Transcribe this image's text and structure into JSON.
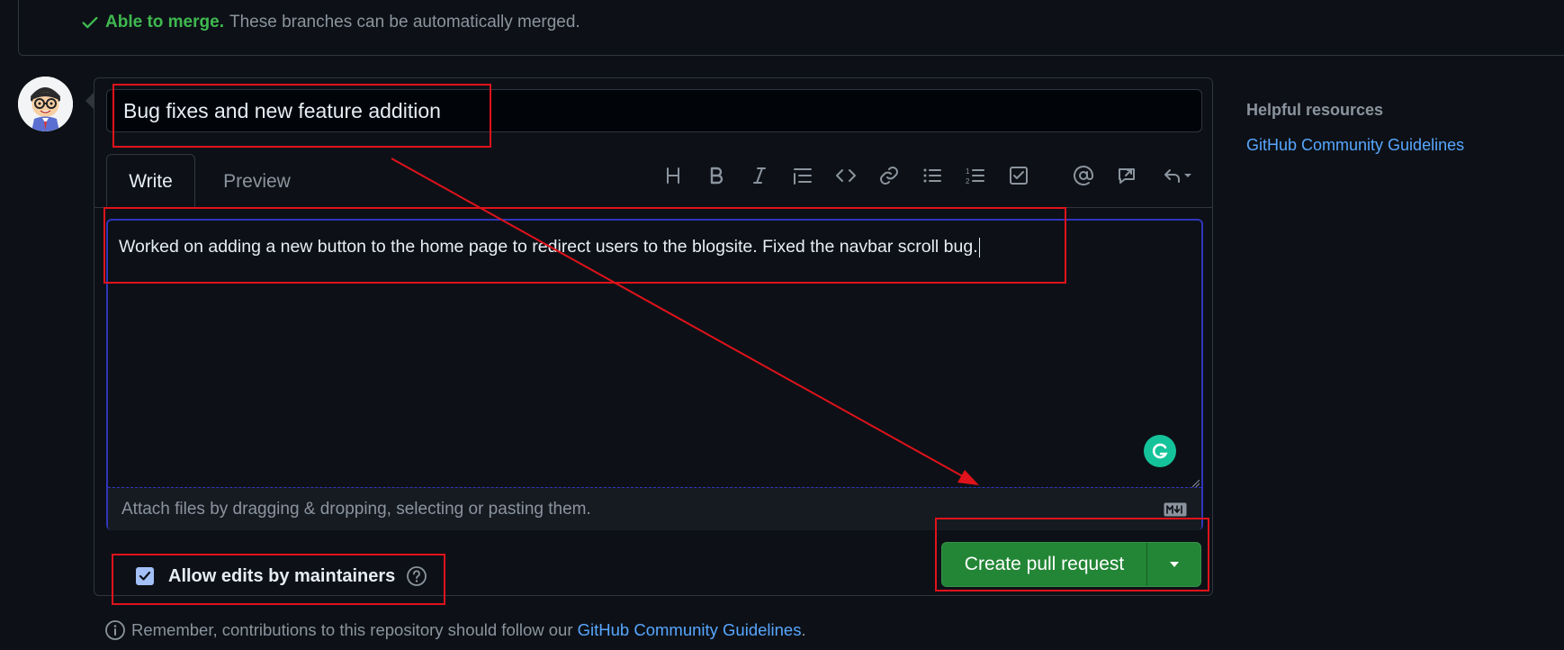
{
  "merge": {
    "status_strong": "Able to merge.",
    "status_text": "These branches can be automatically merged."
  },
  "form": {
    "title_value": "Bug fixes and new feature addition",
    "tabs": [
      {
        "label": "Write",
        "selected": true
      },
      {
        "label": "Preview",
        "selected": false
      }
    ],
    "toolbar_icons": [
      "heading-icon",
      "bold-icon",
      "italic-icon",
      "quote-icon",
      "code-icon",
      "link-icon",
      "bulleted-list-icon",
      "numbered-list-icon",
      "task-list-icon",
      "mention-icon",
      "reference-icon",
      "reply-icon"
    ],
    "body_value": "Worked on adding a new button to the home page to redirect users to the blogsite. Fixed the navbar scroll bug.",
    "attach_text": "Attach files by dragging & dropping, selecting or pasting them.",
    "allow_edits_label": "Allow edits by maintainers",
    "allow_edits_checked": true,
    "create_button_label": "Create pull request"
  },
  "footer": {
    "remember_prefix": "Remember, contributions to this repository should follow our",
    "remember_link": "GitHub Community Guidelines",
    "remember_suffix": "."
  },
  "sidebar": {
    "title": "Helpful resources",
    "link": "GitHub Community Guidelines"
  },
  "colors": {
    "background": "#0d1117",
    "success": "#3fb950",
    "button": "#238636",
    "link": "#58a6ff",
    "annotation": "#e0121b",
    "editor_focus": "#2f35ba"
  }
}
